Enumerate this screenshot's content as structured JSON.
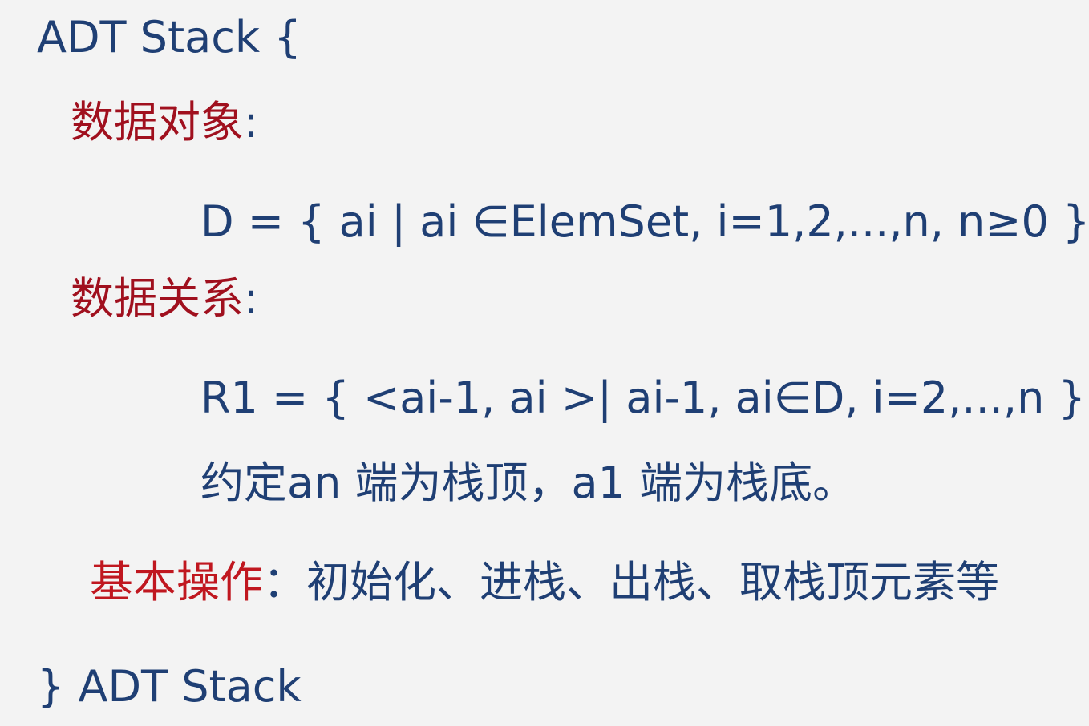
{
  "header": {
    "adt_open": "ADT Stack {"
  },
  "data_object": {
    "label": "数据对象",
    "colon": ":",
    "definition": "D = { ai | ai ∈ElemSet, i=1,2,...,n, n≥0 }"
  },
  "data_relation": {
    "label": "数据关系",
    "colon": ":",
    "definition": "R1 = { <ai-1, ai >| ai-1, ai∈D, i=2,...,n }",
    "convention": "约定an 端为栈顶，a1 端为栈底。"
  },
  "basic_operations": {
    "label": "基本操作",
    "text": "：初始化、进栈、出栈、取栈顶元素等"
  },
  "footer": {
    "adt_close": "} ADT Stack"
  }
}
